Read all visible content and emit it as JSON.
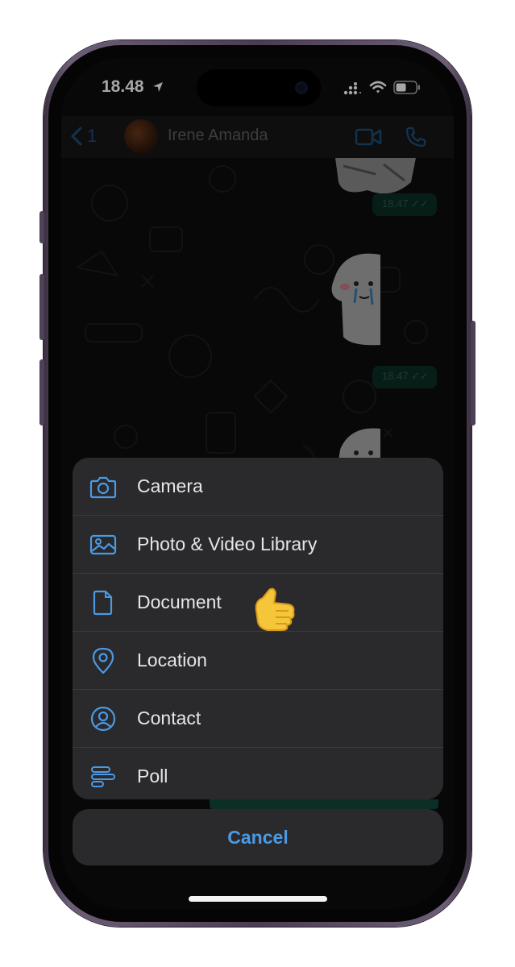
{
  "status_bar": {
    "time": "18.48"
  },
  "header": {
    "back_count": "1",
    "contact_name": "Irene Amanda"
  },
  "messages": [
    {
      "time": "18.47"
    },
    {
      "time": "18.47"
    }
  ],
  "action_sheet": {
    "items": [
      {
        "label": "Camera",
        "icon": "camera-icon"
      },
      {
        "label": "Photo & Video Library",
        "icon": "photo-icon"
      },
      {
        "label": "Document",
        "icon": "document-icon"
      },
      {
        "label": "Location",
        "icon": "location-pin-icon"
      },
      {
        "label": "Contact",
        "icon": "contact-icon"
      },
      {
        "label": "Poll",
        "icon": "poll-icon"
      }
    ],
    "cancel_label": "Cancel"
  },
  "colors": {
    "accent": "#4a9ae6",
    "sheet_bg": "#2a2a2c",
    "sent_bubble": "#0b2e26"
  }
}
